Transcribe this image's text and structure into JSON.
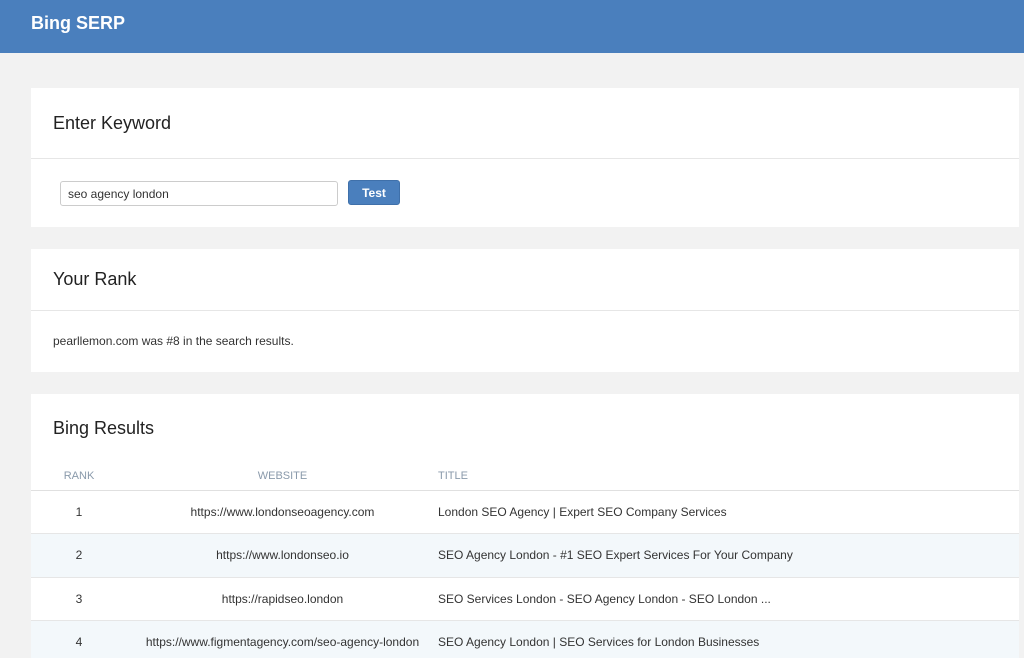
{
  "app": {
    "title": "Bing SERP"
  },
  "keyword_card": {
    "title": "Enter Keyword",
    "input_value": "seo agency london",
    "button_label": "Test"
  },
  "rank_card": {
    "title": "Your Rank",
    "message": "pearllemon.com was #8 in the search results."
  },
  "results_card": {
    "title": "Bing Results",
    "columns": [
      "RANK",
      "WEBSITE",
      "TITLE"
    ],
    "rows": [
      {
        "rank": "1",
        "website": "https://www.londonseoagency.com",
        "title": "London SEO Agency | Expert SEO Company Services"
      },
      {
        "rank": "2",
        "website": "https://www.londonseo.io",
        "title": "SEO Agency London - #1 SEO Expert Services For Your Company"
      },
      {
        "rank": "3",
        "website": "https://rapidseo.london",
        "title": "SEO Services London - SEO Agency London - SEO London ..."
      },
      {
        "rank": "4",
        "website": "https://www.figmentagency.com/seo-agency-london",
        "title": "SEO Agency London | SEO Services for London Businesses"
      }
    ]
  },
  "colors": {
    "header": "#4a7fbd",
    "button": "#4a7fbd",
    "background": "#f2f2f2",
    "row_alt": "#f3f8fb"
  }
}
